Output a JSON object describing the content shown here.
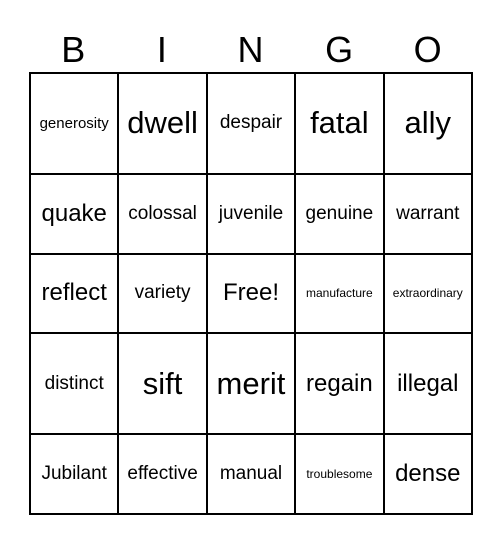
{
  "header": [
    "B",
    "I",
    "N",
    "G",
    "O"
  ],
  "rows": [
    [
      "generosity",
      "dwell",
      "despair",
      "fatal",
      "ally"
    ],
    [
      "quake",
      "colossal",
      "juvenile",
      "genuine",
      "warrant"
    ],
    [
      "reflect",
      "variety",
      "Free!",
      "manufacture",
      "extraordinary"
    ],
    [
      "distinct",
      "sift",
      "merit",
      "regain",
      "illegal"
    ],
    [
      "Jubilant",
      "effective",
      "manual",
      "troublesome",
      "dense"
    ]
  ]
}
